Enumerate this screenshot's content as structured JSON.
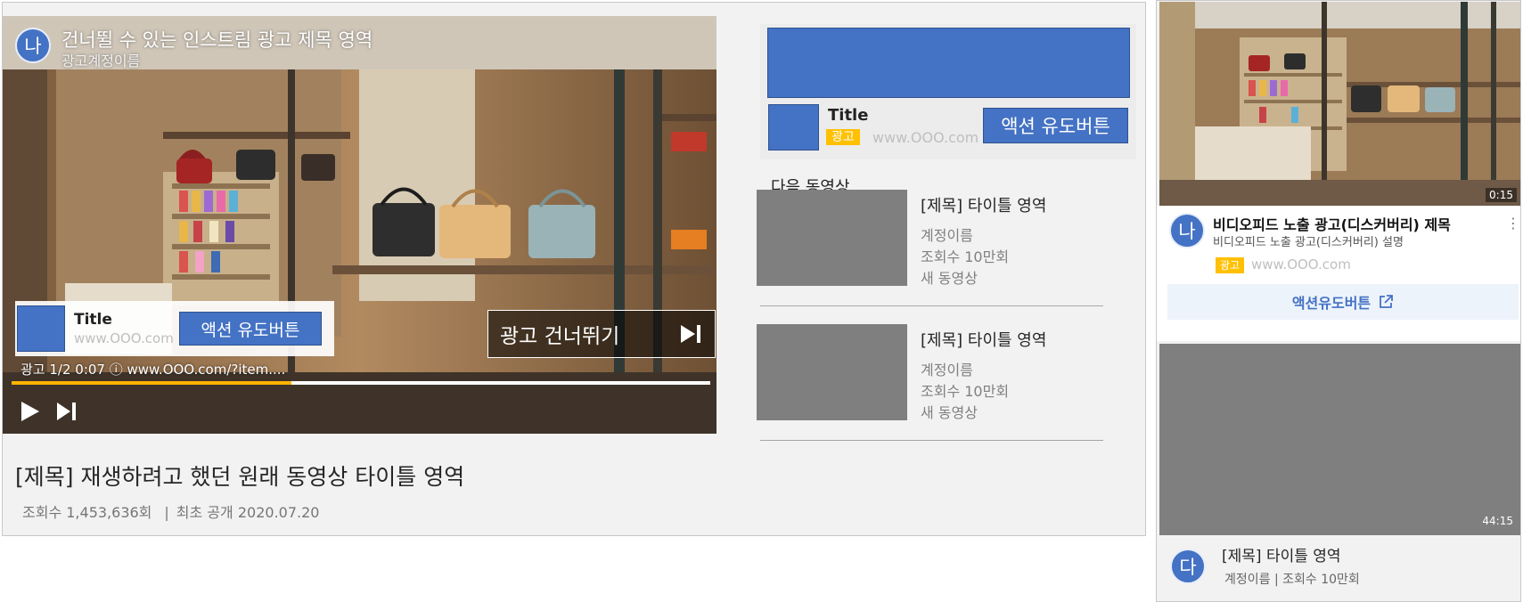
{
  "desktop": {
    "player": {
      "ad_avatar": "나",
      "ad_title": "건너뛸 수 있는 인스트림 광고 제목 영역",
      "ad_account": "광고계정이름",
      "overlay": {
        "title": "Title",
        "url": "www.OOO.com",
        "cta": "액션 유도버튼"
      },
      "skip_label": "광고 건너뛰기",
      "ad_info": "광고 1/2 0:07 ⓘ www.OOO.com/?item....",
      "progress_fraction": 0.4,
      "icons": {
        "play": "play-icon",
        "next": "skip-next-icon",
        "skip": "skip-next-icon"
      },
      "colors": {
        "accent": "#4472c4",
        "progress": "#ffb400"
      }
    },
    "video_title": "[제목] 재생하려고 했던 원래 동영상 타이틀 영역",
    "video_views": "조회수 1,453,636회",
    "video_separator": "|",
    "video_date": "최초 공개 2020.07.20",
    "companion": {
      "title": "Title",
      "badge": "광고",
      "url": "www.OOO.com",
      "cta": "액션 유도버튼",
      "badge_color": "#ffc000"
    },
    "up_next_label": "다음 동영상",
    "up_next": [
      {
        "title": "[제목] 타이틀 영역",
        "account": "계정이름",
        "views": "조회수 10만회",
        "tag": "새 동영상"
      },
      {
        "title": "[제목] 타이틀 영역",
        "account": "계정이름",
        "views": "조회수 10만회",
        "tag": "새 동영상"
      }
    ]
  },
  "mobile": {
    "video_duration": "0:15",
    "ad": {
      "avatar": "나",
      "title": "비디오피드 노출 광고(디스커버리) 제목",
      "description": "비디오피드 노출 광고(디스커버리) 설명",
      "more_icon": "⋮",
      "badge": "광고",
      "url": "www.OOO.com",
      "cta": "액션유도버튼",
      "cta_icon": "external-link-icon"
    },
    "next_duration": "44:15",
    "next_item": {
      "avatar": "다",
      "title": "[제목] 타이틀 영역",
      "meta": "계정이름 | 조회수 10만회"
    }
  }
}
